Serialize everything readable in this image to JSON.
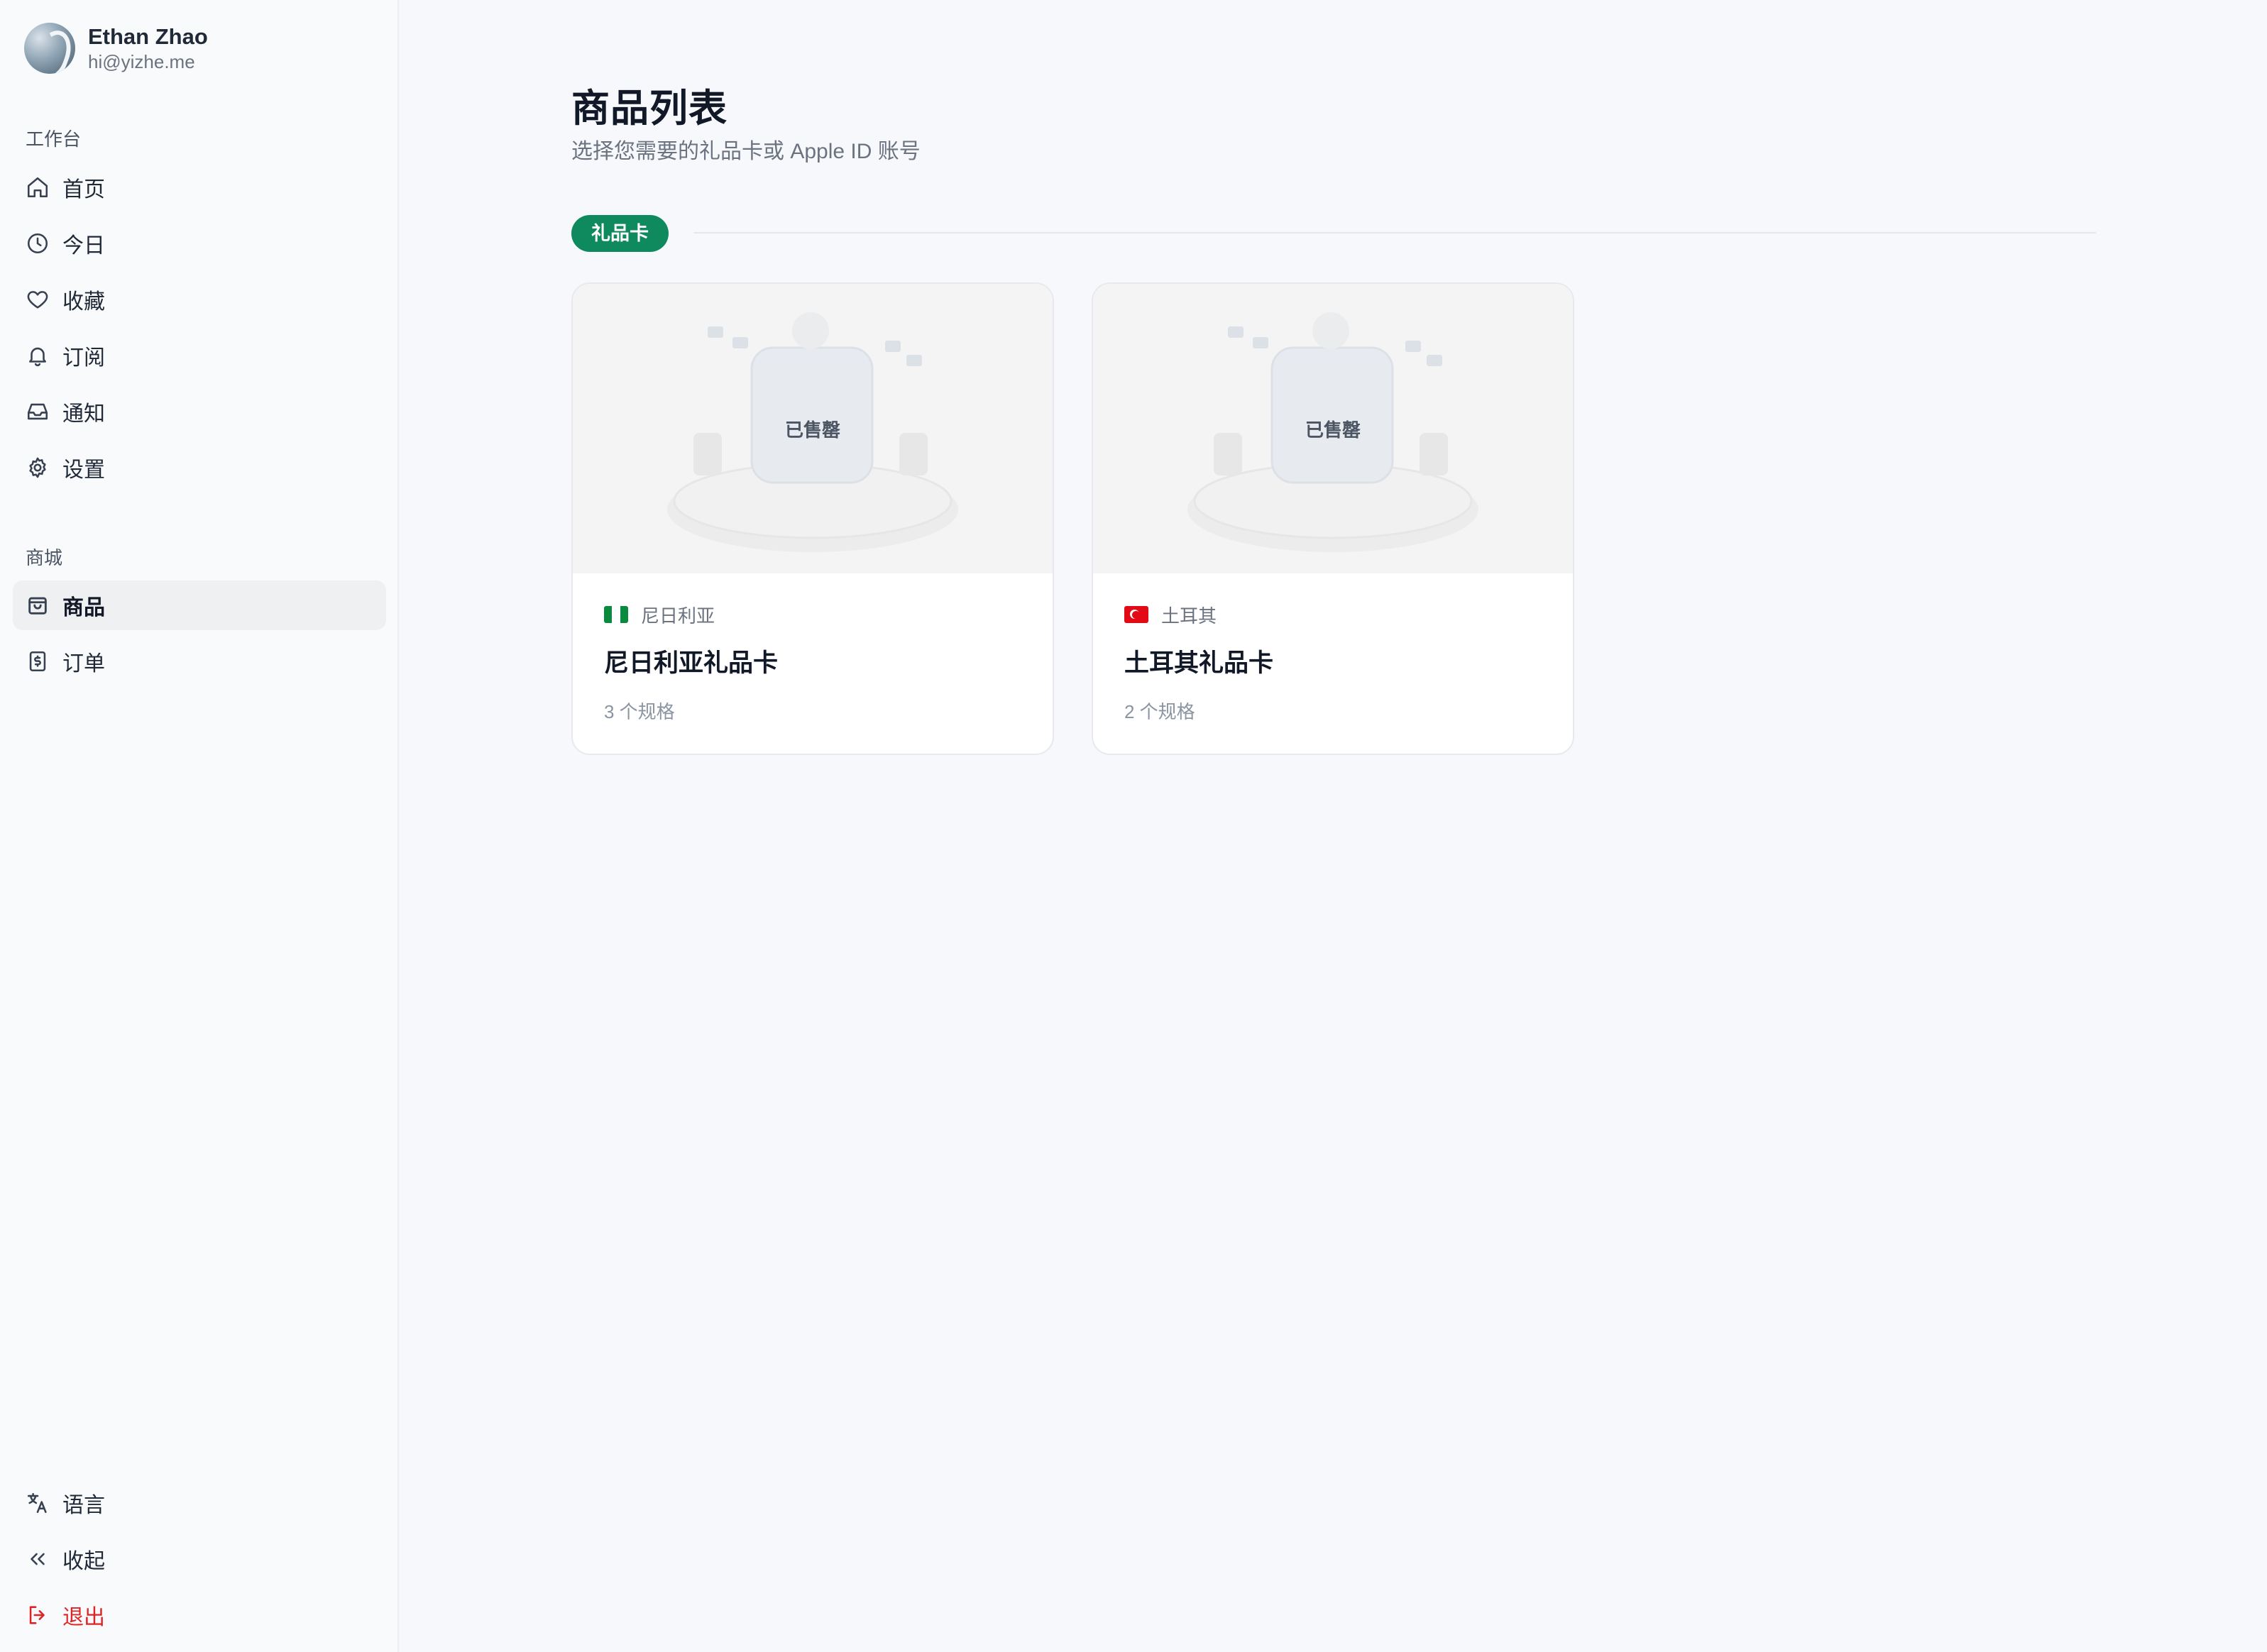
{
  "user": {
    "name": "Ethan Zhao",
    "email": "hi@yizhe.me"
  },
  "sidebar": {
    "workspace_label": "工作台",
    "workspace_items": [
      {
        "label": "首页",
        "icon": "home-icon"
      },
      {
        "label": "今日",
        "icon": "clock-icon"
      },
      {
        "label": "收藏",
        "icon": "heart-icon"
      },
      {
        "label": "订阅",
        "icon": "bell-icon"
      },
      {
        "label": "通知",
        "icon": "inbox-icon"
      },
      {
        "label": "设置",
        "icon": "gear-icon"
      }
    ],
    "shop_label": "商城",
    "shop_items": [
      {
        "label": "商品",
        "icon": "shopping-bag-icon",
        "active": true
      },
      {
        "label": "订单",
        "icon": "receipt-icon"
      }
    ],
    "bottom_items": [
      {
        "label": "语言",
        "icon": "translate-icon"
      },
      {
        "label": "收起",
        "icon": "chevrons-left-icon"
      },
      {
        "label": "退出",
        "icon": "logout-icon",
        "color": "#dc2626"
      }
    ]
  },
  "main": {
    "title": "商品列表",
    "subtitle": "选择您需要的礼品卡或 Apple ID 账号",
    "section_tag": "礼品卡",
    "products": [
      {
        "country": "尼日利亚",
        "flag": "nigeria-flag-icon",
        "title": "尼日利亚礼品卡",
        "specs": "3 个规格",
        "status": "已售罄"
      },
      {
        "country": "土耳其",
        "flag": "turkey-flag-icon",
        "title": "土耳其礼品卡",
        "specs": "2 个规格",
        "status": "已售罄"
      }
    ]
  },
  "colors": {
    "accent": "#0f8a5f",
    "danger": "#dc2626",
    "background": "#f6f8fb"
  }
}
